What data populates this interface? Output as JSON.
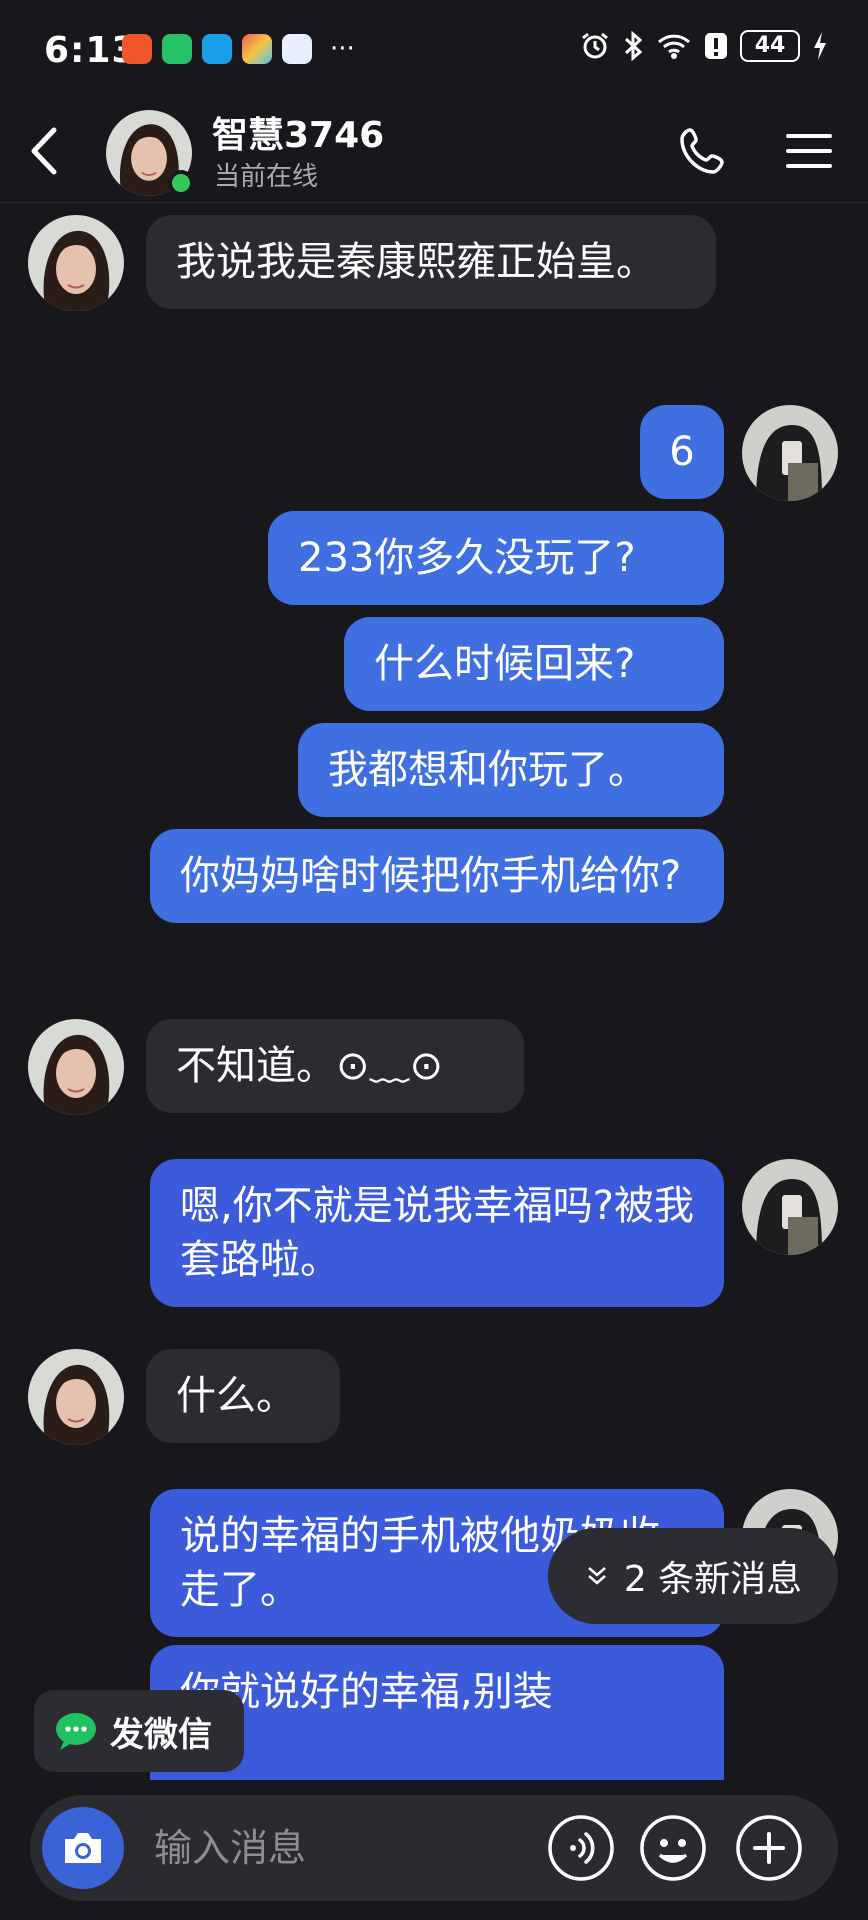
{
  "status_bar": {
    "time": "6:13",
    "battery": "44",
    "more": "···"
  },
  "header": {
    "name": "智慧3746",
    "status": "当前在线"
  },
  "messages": [
    {
      "side": "in",
      "text": "我说我是秦康熙雍正始皇。"
    },
    {
      "side": "out",
      "text": "6"
    },
    {
      "side": "out",
      "text": "233你多久没玩了?"
    },
    {
      "side": "out",
      "text": "什么时候回来?"
    },
    {
      "side": "out",
      "text": "我都想和你玩了。"
    },
    {
      "side": "out",
      "text": "你妈妈啥时候把你手机给你?"
    },
    {
      "side": "in",
      "text": "不知道。⊙﹏⊙"
    },
    {
      "side": "out",
      "text": "嗯,你不就是说我幸福吗?被我套路啦。"
    },
    {
      "side": "in",
      "text": "什么。"
    },
    {
      "side": "out",
      "text": "说的幸福的手机被他奶奶收走了。"
    },
    {
      "side": "out",
      "text": "你就说好的幸福,别装"
    }
  ],
  "new_messages": {
    "label": "2 条新消息"
  },
  "wechat_button": {
    "label": "发微信"
  },
  "input": {
    "placeholder": "输入消息"
  },
  "icons": {
    "back": "back-arrow-icon",
    "call": "phone-icon",
    "menu": "menu-icon",
    "camera": "camera-icon",
    "voice": "voice-icon",
    "emoji": "emoji-icon",
    "add": "plus-icon",
    "chevron": "chevron-down-icon",
    "wechat": "wechat-icon"
  },
  "colors": {
    "background": "#17171c",
    "incoming_bubble": "#2b2b31",
    "outgoing_bubble": "#3f6fe0",
    "online": "#35c759",
    "accent": "#3b63d8"
  }
}
